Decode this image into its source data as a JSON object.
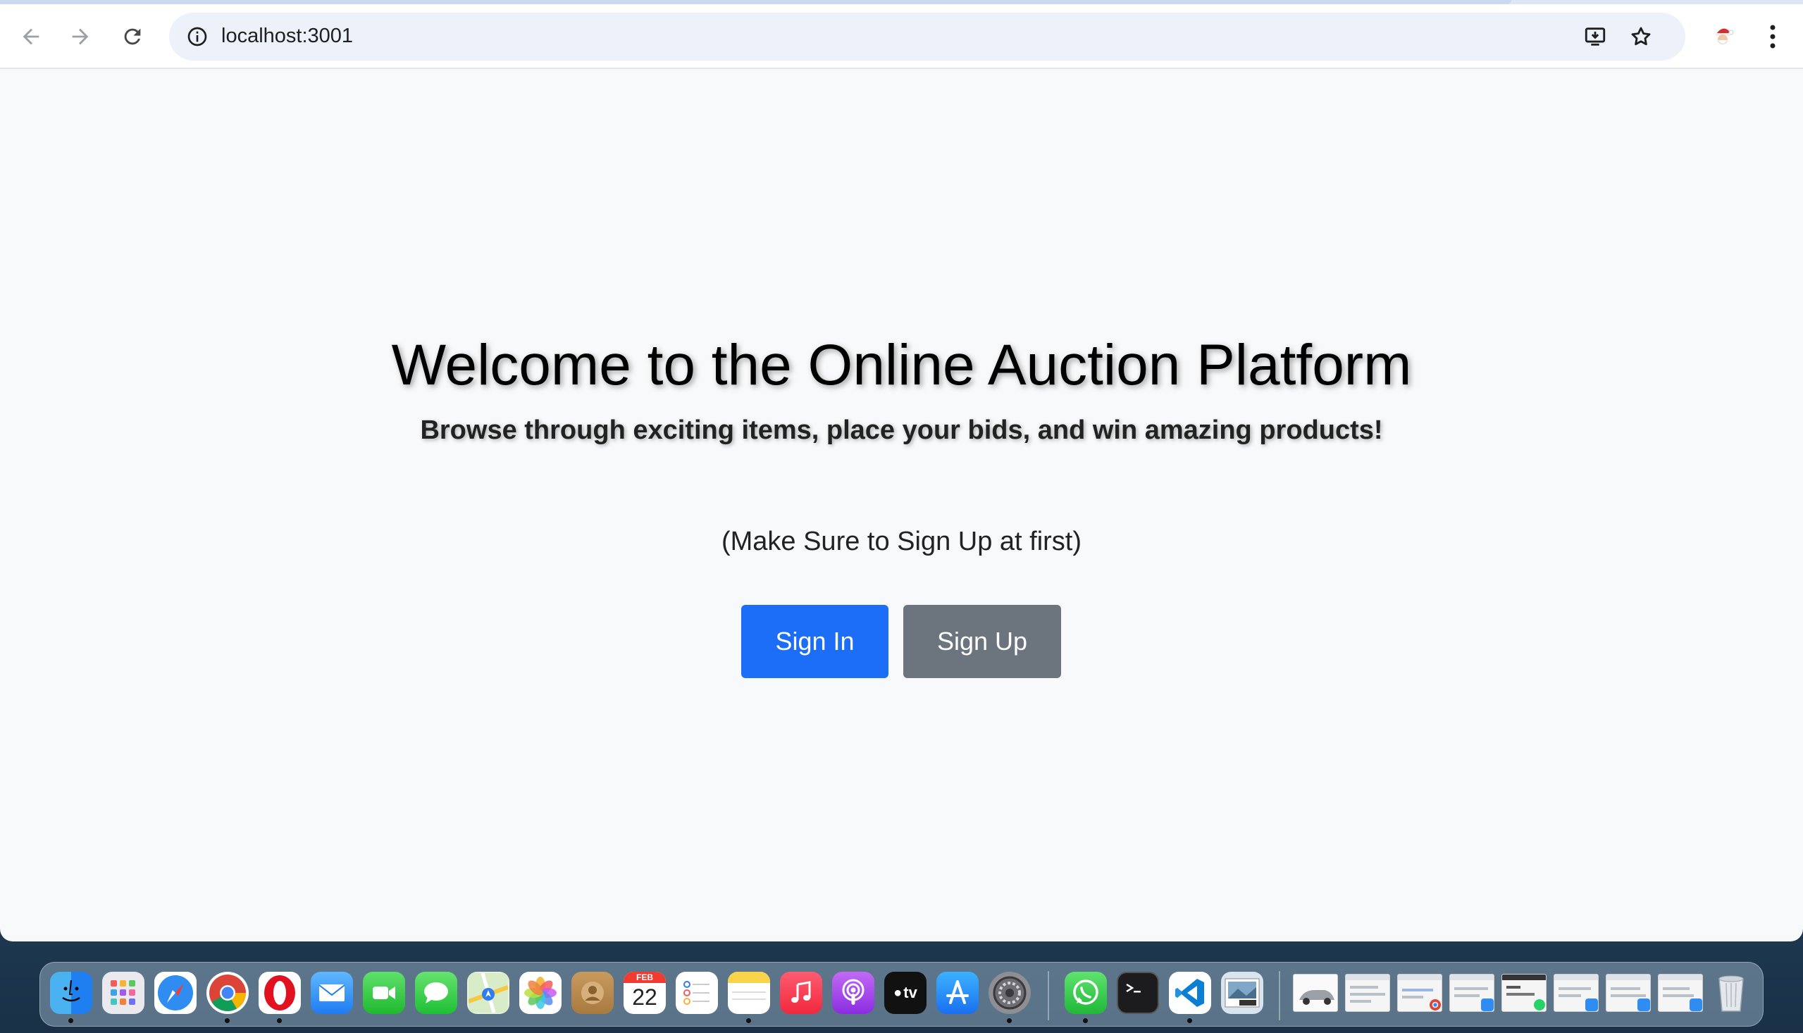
{
  "browser": {
    "url": "localhost:3001"
  },
  "page": {
    "title": "Welcome to the Online Auction Platform",
    "subtitle": "Browse through exciting items, place your bids, and win amazing products!",
    "note": "(Make Sure to Sign Up at first)",
    "signin_label": "Sign In",
    "signup_label": "Sign Up"
  },
  "colors": {
    "signin_button": "#1b6ef5",
    "signup_button": "#6c757d",
    "page_background": "#f8f9fa"
  },
  "dock": {
    "calendar_month": "FEB",
    "calendar_day": "22",
    "tv_label": "tv",
    "apps": [
      "finder-icon",
      "launchpad-icon",
      "safari-icon",
      "chrome-icon",
      "opera-icon",
      "mail-icon",
      "facetime-icon",
      "messages-icon",
      "maps-icon",
      "photos-icon",
      "contacts-icon",
      "calendar-icon",
      "reminders-icon",
      "notes-icon",
      "music-icon",
      "podcasts-icon",
      "apple-tv-icon",
      "app-store-icon",
      "system-settings-icon",
      "whatsapp-icon",
      "terminal-icon",
      "vscode-icon",
      "preview-icon"
    ]
  }
}
